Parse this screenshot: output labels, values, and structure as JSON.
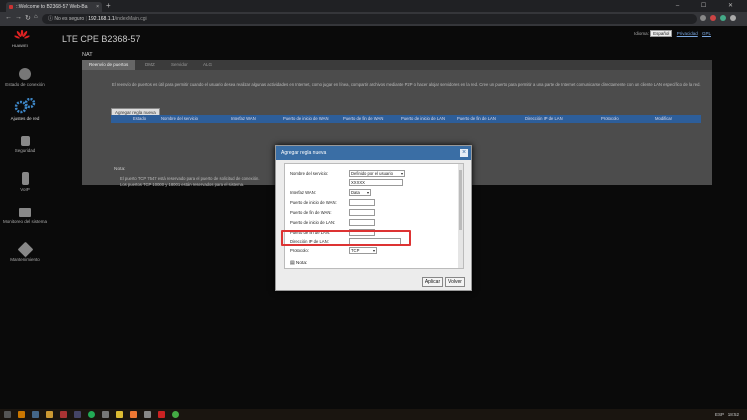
{
  "browser": {
    "tab_title": "::Welcome to B2368-57 Web-Ba",
    "tab_close": "×",
    "new_tab": "+",
    "window_controls": "–  ☐  ✕",
    "nav": {
      "back": "←",
      "forward": "→",
      "reload": "↻",
      "home": "⌂"
    },
    "insecure_label": "No es seguro",
    "url_host": "192.168.1.1",
    "url_path": "/indexMain.cgi"
  },
  "header": {
    "logo_text": "HUAWEI",
    "product": "LTE CPE B2368-57",
    "language_label": "Idioma:",
    "language_value": "Español",
    "privacy_link": "Privacidad",
    "other_link": "GPL"
  },
  "sidebar": {
    "items": [
      {
        "label": "Estado de conexión",
        "icon": "globe-icon"
      },
      {
        "label": "Ajustes de red",
        "icon": "gears-icon"
      },
      {
        "label": "Seguridad",
        "icon": "lock-icon"
      },
      {
        "label": "VoIP",
        "icon": "phone-icon"
      },
      {
        "label": "Monitoreo del sistema",
        "icon": "monitor-icon"
      },
      {
        "label": "Mantenimiento",
        "icon": "tools-icon"
      }
    ]
  },
  "main": {
    "section_title": "NAT",
    "tabs": [
      "Reenvío de puertos",
      "DMZ",
      "Servidor",
      "ALG"
    ],
    "description": "El reenvío de puertos es útil para permitir cuando el usuario desea realizar algunas actividades en Internet, como jugar en línea, compartir archivos mediante P2P o hacer alojar servidores en la red. Cree un puerto para permitir a una parte de Internet comunicarse directamente con un cliente LAN específico de la red.",
    "add_rule_label": "Agregar regla nueva",
    "columns": [
      "Estado",
      "Nombre del servicio",
      "Interfaz WAN",
      "Puerto de inicio de WAN",
      "Puerto de fin de WAN",
      "Puerto de inicio de LAN",
      "Puerto de fin de LAN",
      "Dirección IP de LAN",
      "Protocolo",
      "Modificar"
    ],
    "note_title": "Nota:",
    "note_lines": [
      "El puerto TCP 7547 está reservado para el puerto de solicitud de conexión.",
      "Los puertos TCP 10000 y 18001 están reservados para el sistema."
    ]
  },
  "modal": {
    "title": "Agregar regla nueva",
    "close": "×",
    "fields": {
      "service_name_label": "Nombre del servicio:",
      "service_name_value": "Definido por el usuario",
      "service_name_text": "XXXXX",
      "wan_interface_label": "Interfaz WAN:",
      "wan_interface_value": "Data",
      "wan_start_label": "Puerto de inicio de WAN:",
      "wan_end_label": "Puerto de fin de WAN:",
      "lan_start_label": "Puerto de inicio de LAN:",
      "lan_end_label": "Puerto de fin de LAN:",
      "lan_ip_label": "Dirección IP de LAN:",
      "protocol_label": "Protocolo:",
      "protocol_value": "TCP"
    },
    "note_label": "Nota:",
    "apply_label": "Aplicar",
    "back_label": "Volver"
  },
  "taskbar": {
    "lang": "ESP",
    "time": "18:52"
  },
  "colors": {
    "modal_header": "#3a6ea5",
    "table_header": "#2d5e9a",
    "highlight": "#dd3333"
  }
}
